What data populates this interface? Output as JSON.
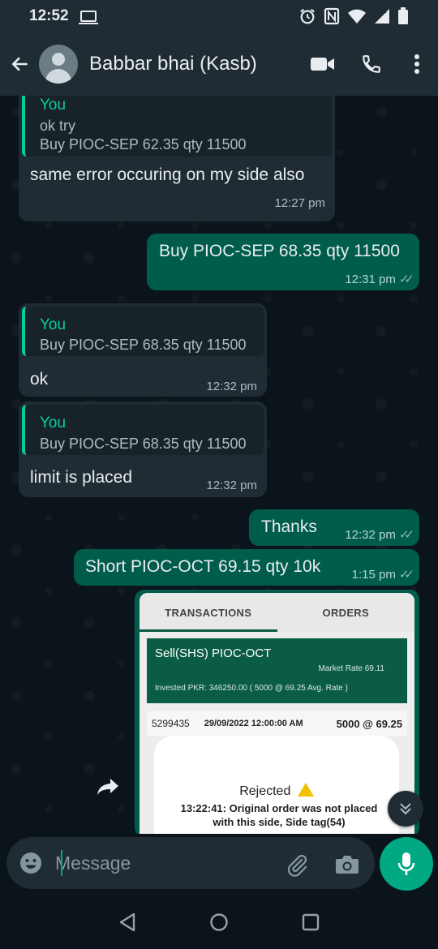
{
  "status_bar": {
    "time": "12:52"
  },
  "header": {
    "contact_name": "Babbar bhai (Kasb)"
  },
  "messages": [
    {
      "direction": "in",
      "quote_author": "You",
      "quote_lines": [
        "ok try",
        "Buy PIOC-SEP 62.35 qty 11500"
      ],
      "text": "same error occuring on my side also",
      "time": "12:27 pm"
    },
    {
      "direction": "out",
      "text": "Buy PIOC-SEP 68.35 qty 11500",
      "time": "12:31 pm",
      "read": true
    },
    {
      "direction": "in",
      "quote_author": "You",
      "quote_lines": [
        "Buy PIOC-SEP 68.35 qty 11500"
      ],
      "text": "ok",
      "time": "12:32 pm"
    },
    {
      "direction": "in",
      "quote_author": "You",
      "quote_lines": [
        "Buy PIOC-SEP 68.35 qty 11500"
      ],
      "text": "limit is placed",
      "time": "12:32 pm"
    },
    {
      "direction": "out",
      "text": "Thanks",
      "time": "12:32 pm",
      "read": true
    },
    {
      "direction": "out",
      "text": "Short PIOC-OCT 69.15 qty 10k",
      "time": "1:15 pm",
      "read": true
    }
  ],
  "image_message": {
    "tabs": [
      "TRANSACTIONS",
      "ORDERS"
    ],
    "order_title": "Sell(SHS) PIOC-OCT",
    "market_rate": "Market Rate 69.11",
    "invested": "Invested PKR: 346250.00 ( 5000  @ 69.25 Avg. Rate  )",
    "row": {
      "id": "5299435",
      "date": "29/09/2022 12:00:00 AM",
      "qty": "5000 @ 69.25"
    },
    "rejected_title": "Rejected",
    "rejected_line1": "13:22:41: Original order was not placed",
    "rejected_line2": "with this side, Side tag(54)"
  },
  "composer": {
    "placeholder": "Message"
  }
}
